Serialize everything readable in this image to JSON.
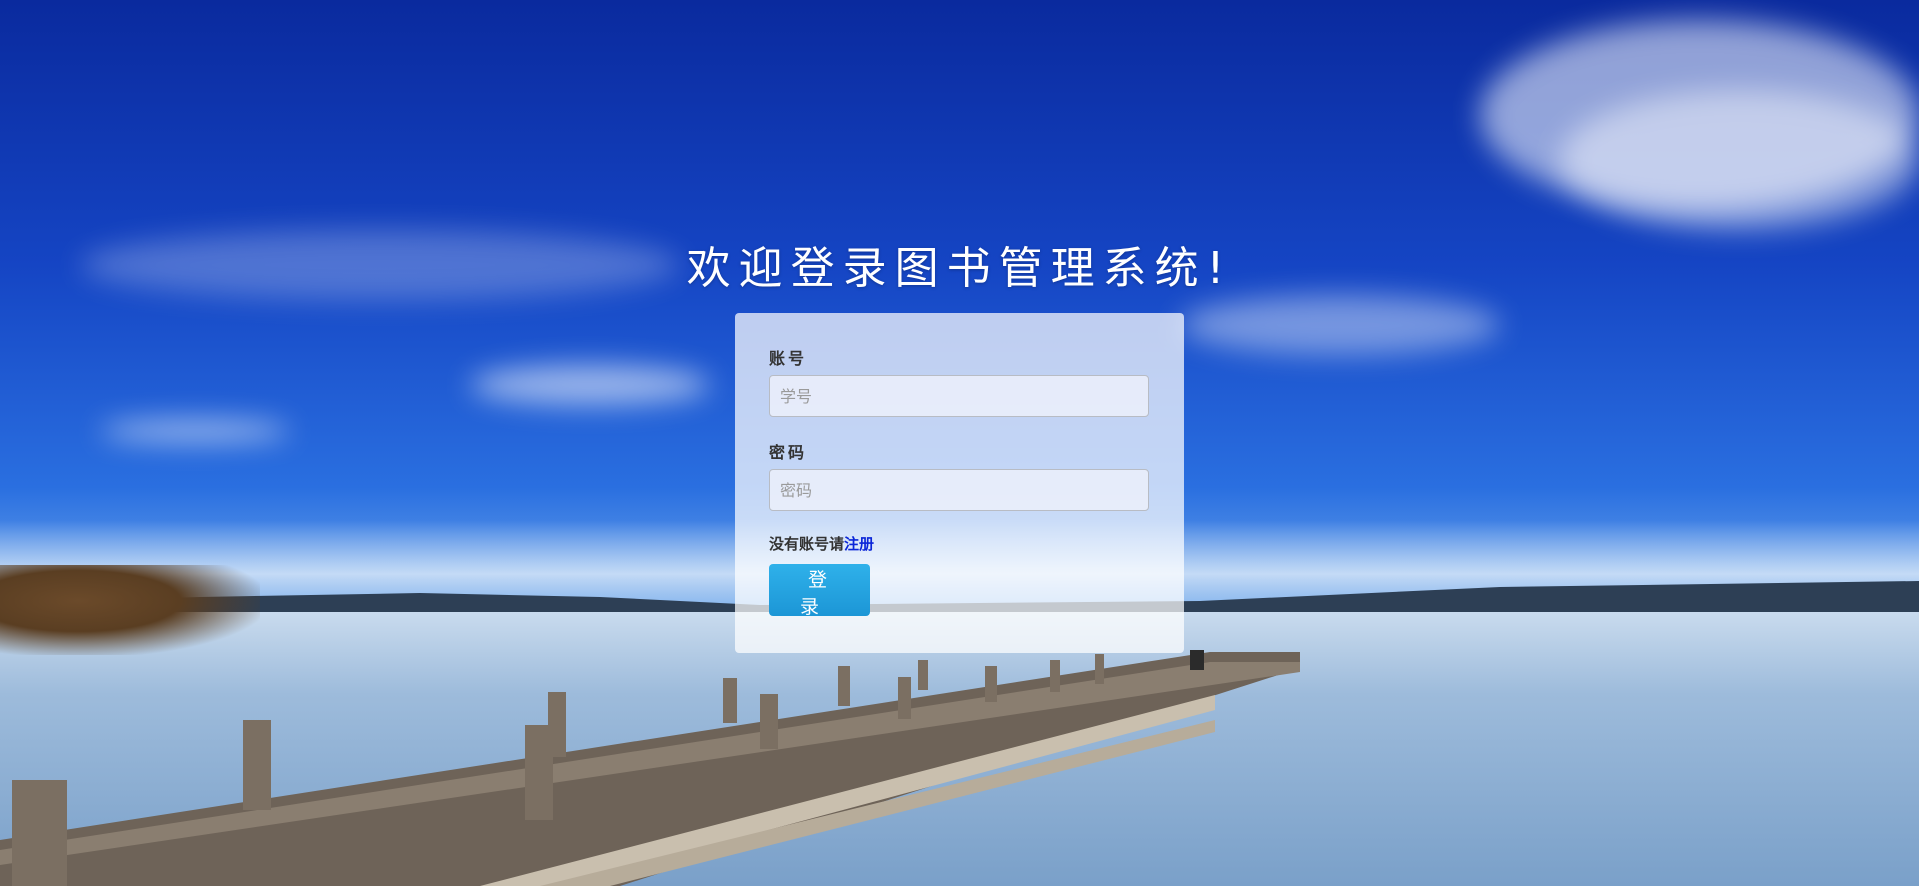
{
  "page": {
    "title": "欢迎登录图书管理系统!"
  },
  "login_form": {
    "account": {
      "label": "账号",
      "placeholder": "学号",
      "value": ""
    },
    "password": {
      "label": "密码",
      "placeholder": "密码",
      "value": ""
    },
    "register_prompt": "没有账号请",
    "register_link": "注册",
    "login_button": "登 录"
  },
  "colors": {
    "login_button": "#1fa3e0",
    "register_link": "#0b26d8",
    "title_text": "#ffffff"
  }
}
